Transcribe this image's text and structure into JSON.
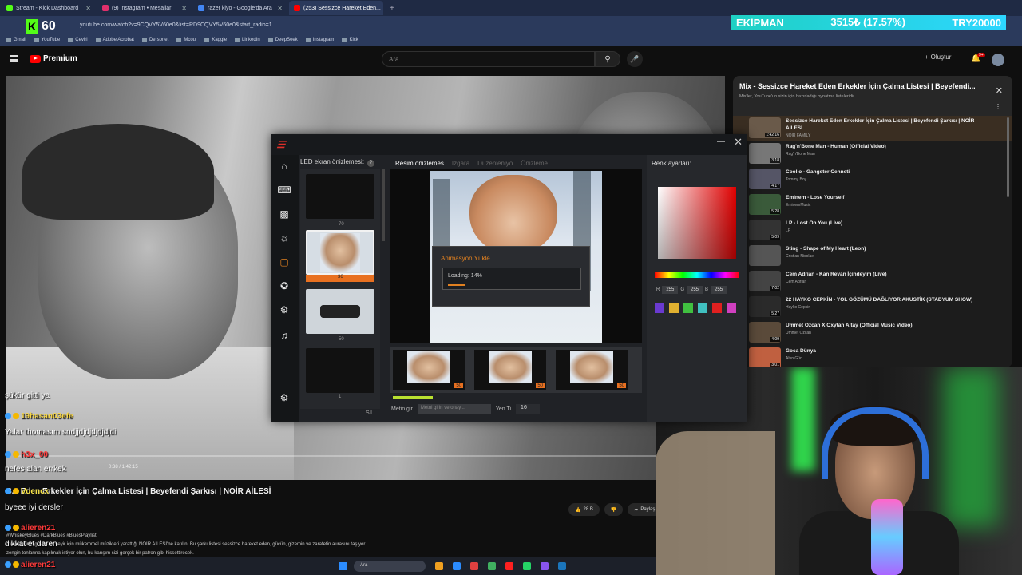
{
  "browser": {
    "tabs": [
      {
        "label": "Stream - Kick Dashboard",
        "color": "#53fc18",
        "active": false
      },
      {
        "label": "(9) Instagram • Mesajlar",
        "color": "#e1306c",
        "active": false
      },
      {
        "label": "razer kiyo - Google'da Ara",
        "color": "#4285f4",
        "active": false
      },
      {
        "label": "(253) Sessizce Hareket Eden...",
        "color": "#ff0000",
        "active": true
      }
    ],
    "url": "youtube.com/watch?v=9CQVY5V60e0&list=RD9CQVY5V60e0&start_radio=1",
    "bookmarks": [
      "Gmail",
      "YouTube",
      "Çeviri",
      "Adobe Acrobat",
      "Dersonet",
      "Mcoul",
      "Kaggle",
      "LinkedIn",
      "DeepSeek",
      "Instagram",
      "Kick"
    ]
  },
  "kick_badge": {
    "letter": "K",
    "count": "60"
  },
  "ticker": {
    "left": "EKİPMAN",
    "middle": "3515₺ (17.57%)",
    "right": "TRY20000"
  },
  "youtube": {
    "logo": "Premium",
    "search_placeholder": "Ara",
    "create_label": "Oluştur",
    "notif_count": "9+",
    "video_title": "S... Eden Erkekler İçin Çalma Listesi | Beyefendi Şarkısı | NOİR AİLESİ",
    "time": "0:38 / 1:42:15",
    "likes": "28 B",
    "share": "Paylaş",
    "description_1": "#WhiskeyBlues #DarkBlues #BluesPlaylist",
    "description_2": "melodilerinin güven ve seyir için mükemmel müzikleri yarattığı NOIR AİLESİ'ne katılın. Bu şarkı listesi sessizce hareket eden, gücün, gizemin ve zarafetin aurasını taşıyor.",
    "description_3": "zengin tonlarına kapılmak istiyor olun, bu karışım sizi gerçek bir patron gibi hissettirecek."
  },
  "playlist": {
    "title": "Mix - Sessizce Hareket Eden Erkekler İçin Çalma Listesi | Beyefendi...",
    "subtitle": "Mix'ler, YouTube'un sizin için hazırladığı oynatma listeleridir",
    "items": [
      {
        "name": "Sessizce Hareket Eden Erkekler İçin Çalma Listesi | Beyefendi Şarkısı | NOİR AİLESİ",
        "artist": "NOIR FAMILY",
        "dur": "1:42:16",
        "color": "#6a5a4a"
      },
      {
        "name": "Rag'n'Bone Man - Human (Official Video)",
        "artist": "Rag'n'Bone Man",
        "dur": "3:18",
        "color": "#777"
      },
      {
        "name": "Coolio - Gangster Cenneti",
        "artist": "Tommy Boy",
        "dur": "4:17",
        "color": "#556"
      },
      {
        "name": "Eminem - Lose Yourself",
        "artist": "EminemMusic",
        "dur": "5:28",
        "color": "#3a5a3a"
      },
      {
        "name": "LP - Lost On You (Live)",
        "artist": "LP",
        "dur": "5:09",
        "color": "#333"
      },
      {
        "name": "Sting - Shape of My Heart (Leon)",
        "artist": "Cristian Nicolae",
        "dur": "",
        "color": "#555"
      },
      {
        "name": "Cem Adrian - Kan Revan İçindeyim (Live)",
        "artist": "Cem Adrian",
        "dur": "7:02",
        "color": "#444"
      },
      {
        "name": "22 HAYKO CEPKİN - YOL GÖZÜMÜ DAĞLIYOR AKUSTİK (STADYUM SHOW)",
        "artist": "Hayko Cepkin",
        "dur": "5:27",
        "color": "#2a2a2a"
      },
      {
        "name": "Ummet Ozcan X Oxytan Altay (Official Music Video)",
        "artist": "Ummet Ozcan",
        "dur": "4:09",
        "color": "#5a4a3a"
      },
      {
        "name": "Goca Dünya",
        "artist": "Altın Gün",
        "dur": "3:01",
        "color": "#c06040"
      }
    ]
  },
  "chat": [
    {
      "name": "",
      "msg": "şükür gitti ya",
      "color": "#ffffff"
    },
    {
      "name": "19hasan03efe",
      "msg": "",
      "color": "#f5d547"
    },
    {
      "name": "",
      "msg": "Yalar thomasım sndjjdjdjdjdjdjdi",
      "color": "#ffffff"
    },
    {
      "name": "h3x_00",
      "msg": "",
      "color": "#ff3a3a"
    },
    {
      "name": "",
      "msg": "nefes alan errkek",
      "color": "#ffffff"
    },
    {
      "name": "Vuencx",
      "msg": "",
      "color": "#f5e147"
    },
    {
      "name": "",
      "msg": "byeee iyi dersler",
      "color": "#ffffff"
    },
    {
      "name": "alieren21",
      "msg": "",
      "color": "#ff3a3a"
    },
    {
      "name": "",
      "msg": "dikkat et daren",
      "color": "#ffffff"
    },
    {
      "name": "alieren21",
      "msg": "",
      "color": "#ff3a3a"
    }
  ],
  "rgbapp": {
    "led_header": "LED ekran önizlemesi:",
    "preview_tabs": [
      "Resim önizlemes",
      "Izgara",
      "Düzenleniyo",
      "Önizleme"
    ],
    "color_header": "Renk ayarları:",
    "led_labels": [
      "70",
      "36",
      "50",
      "1"
    ],
    "sil": "Sil",
    "loading_title": "Animasyon Yükle",
    "loading_text": "Loading: 14%",
    "loading_progress": 0.14,
    "strip_nums": [
      "50",
      "50",
      "50"
    ],
    "metin_label": "Metin gir",
    "metin_placeholder": "Metni girin ve onay...",
    "font_label": "Yen Ti",
    "font_value": "16",
    "rgb": {
      "r": "255",
      "g": "255",
      "b": "255"
    },
    "swatches": [
      "#6a3ad0",
      "#e0b030",
      "#40c040",
      "#40c0c0",
      "#e02020",
      "#d040c0"
    ]
  },
  "taskbar": {
    "search": "Ara"
  }
}
